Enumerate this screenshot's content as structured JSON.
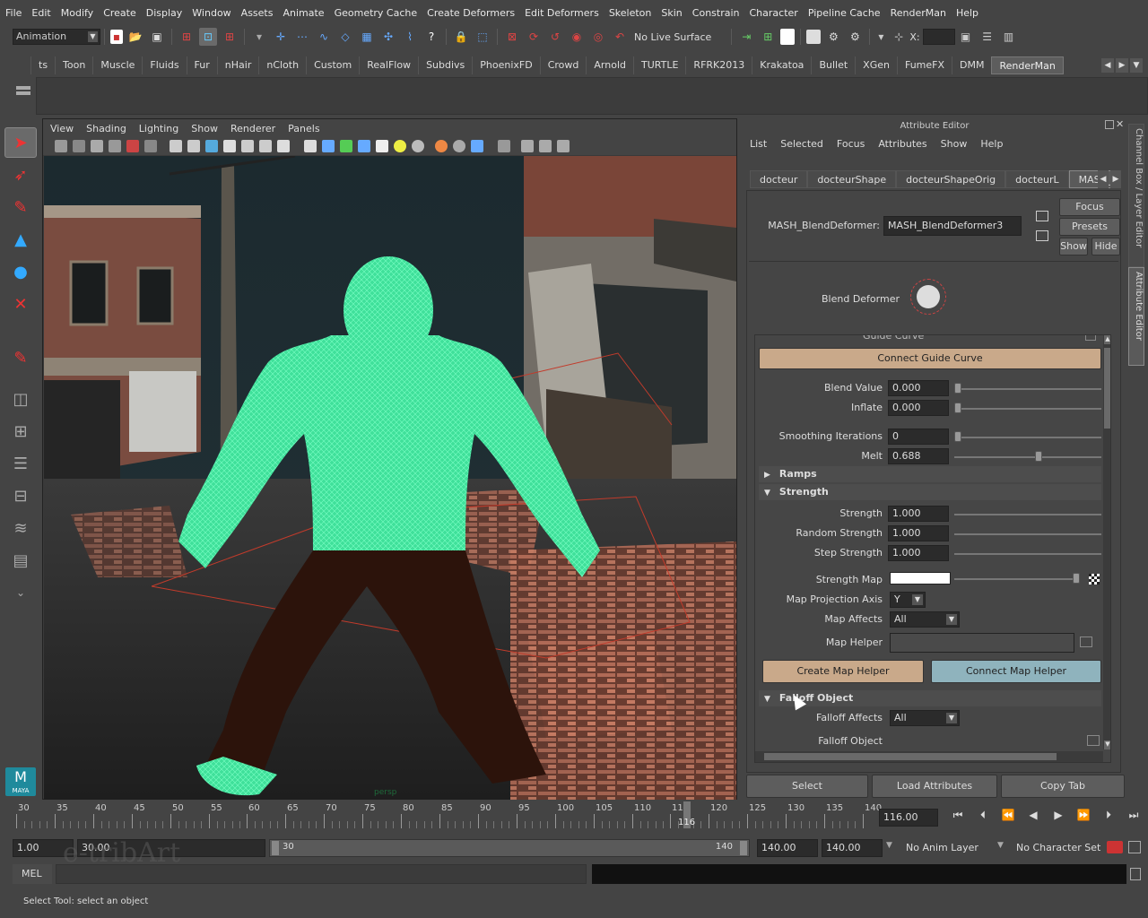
{
  "menubar": [
    "File",
    "Edit",
    "Modify",
    "Create",
    "Display",
    "Window",
    "Assets",
    "Animate",
    "Geometry Cache",
    "Create Deformers",
    "Edit Deformers",
    "Skeleton",
    "Skin",
    "Constrain",
    "Character",
    "Pipeline Cache",
    "RenderMan",
    "Help"
  ],
  "statusline": {
    "mode": "Animation",
    "live_surface": "No Live Surface",
    "x_label": "X:"
  },
  "shelf_tabs": [
    "ts",
    "Toon",
    "Muscle",
    "Fluids",
    "Fur",
    "nHair",
    "nCloth",
    "Custom",
    "RealFlow",
    "Subdivs",
    "PhoenixFD",
    "Crowd",
    "Arnold",
    "TURTLE",
    "RFRK2013",
    "Krakatoa",
    "Bullet",
    "XGen",
    "FumeFX",
    "DMM",
    "RenderMan"
  ],
  "shelf_active": "RenderMan",
  "viewport": {
    "menu": [
      "View",
      "Shading",
      "Lighting",
      "Show",
      "Renderer",
      "Panels"
    ],
    "persp_label": "persp"
  },
  "attr_editor": {
    "title": "Attribute Editor",
    "menu": [
      "List",
      "Selected",
      "Focus",
      "Attributes",
      "Show",
      "Help"
    ],
    "tabs": [
      "docteur",
      "docteurShape",
      "docteurShapeOrig",
      "docteurL",
      "MASH_Bl"
    ],
    "node_label": "MASH_BlendDeformer:",
    "node_value": "MASH_BlendDeformer3",
    "buttons": {
      "focus": "Focus",
      "presets": "Presets",
      "show": "Show",
      "hide": "Hide"
    },
    "blend_deformer_label": "Blend Deformer",
    "guide_curve_label": "Guide Curve",
    "connect_guide": "Connect Guide Curve",
    "fields": {
      "blend_value": {
        "label": "Blend Value",
        "value": "0.000",
        "level": 0.0
      },
      "inflate": {
        "label": "Inflate",
        "value": "0.000",
        "level": 0.0
      },
      "smoothing": {
        "label": "Smoothing Iterations",
        "value": "0",
        "level": 0.0
      },
      "melt": {
        "label": "Melt",
        "value": "0.688",
        "level": 0.578
      }
    },
    "sections": {
      "ramps": "Ramps",
      "strength": "Strength",
      "falloff": "Falloff Object"
    },
    "strength_fields": {
      "strength": {
        "label": "Strength",
        "value": "1.000"
      },
      "random_strength": {
        "label": "Random Strength",
        "value": "1.000"
      },
      "step_strength": {
        "label": "Step Strength",
        "value": "1.000"
      }
    },
    "strength_map_label": "Strength Map",
    "map_projection_axis": {
      "label": "Map Projection Axis",
      "value": "Y"
    },
    "map_affects": {
      "label": "Map Affects",
      "value": "All"
    },
    "map_helper_label": "Map Helper",
    "create_map_helper": "Create Map Helper",
    "connect_map_helper": "Connect Map Helper",
    "falloff_affects": {
      "label": "Falloff Affects",
      "value": "All"
    },
    "falloff_object_label": "Falloff Object",
    "bottom": {
      "select": "Select",
      "load": "Load Attributes",
      "copy": "Copy Tab"
    }
  },
  "side_tabs": [
    "Channel Box / Layer Editor",
    "Attribute Editor"
  ],
  "timeline": {
    "ticks": [
      "30",
      "35",
      "40",
      "45",
      "50",
      "55",
      "60",
      "65",
      "70",
      "75",
      "80",
      "85",
      "90",
      "95",
      "100",
      "105",
      "110",
      "115",
      "120",
      "125",
      "130",
      "135",
      "140"
    ],
    "current_frame": "116",
    "current_field": "116.00"
  },
  "range": {
    "start": "1.00",
    "range_start": "30.00",
    "slider_start": "30",
    "slider_end": "140",
    "range_end": "140.00",
    "end": "140.00",
    "anim_layer": "No Anim Layer",
    "char_set": "No Character Set"
  },
  "cmdline": {
    "label": "MEL",
    "watermark": "e-tribArt"
  },
  "helpline": "Select Tool: select an object",
  "colors": {
    "accent_tan": "#c9a98a",
    "accent_blue": "#8fb3bd",
    "wire_green": "#4de9a0"
  }
}
